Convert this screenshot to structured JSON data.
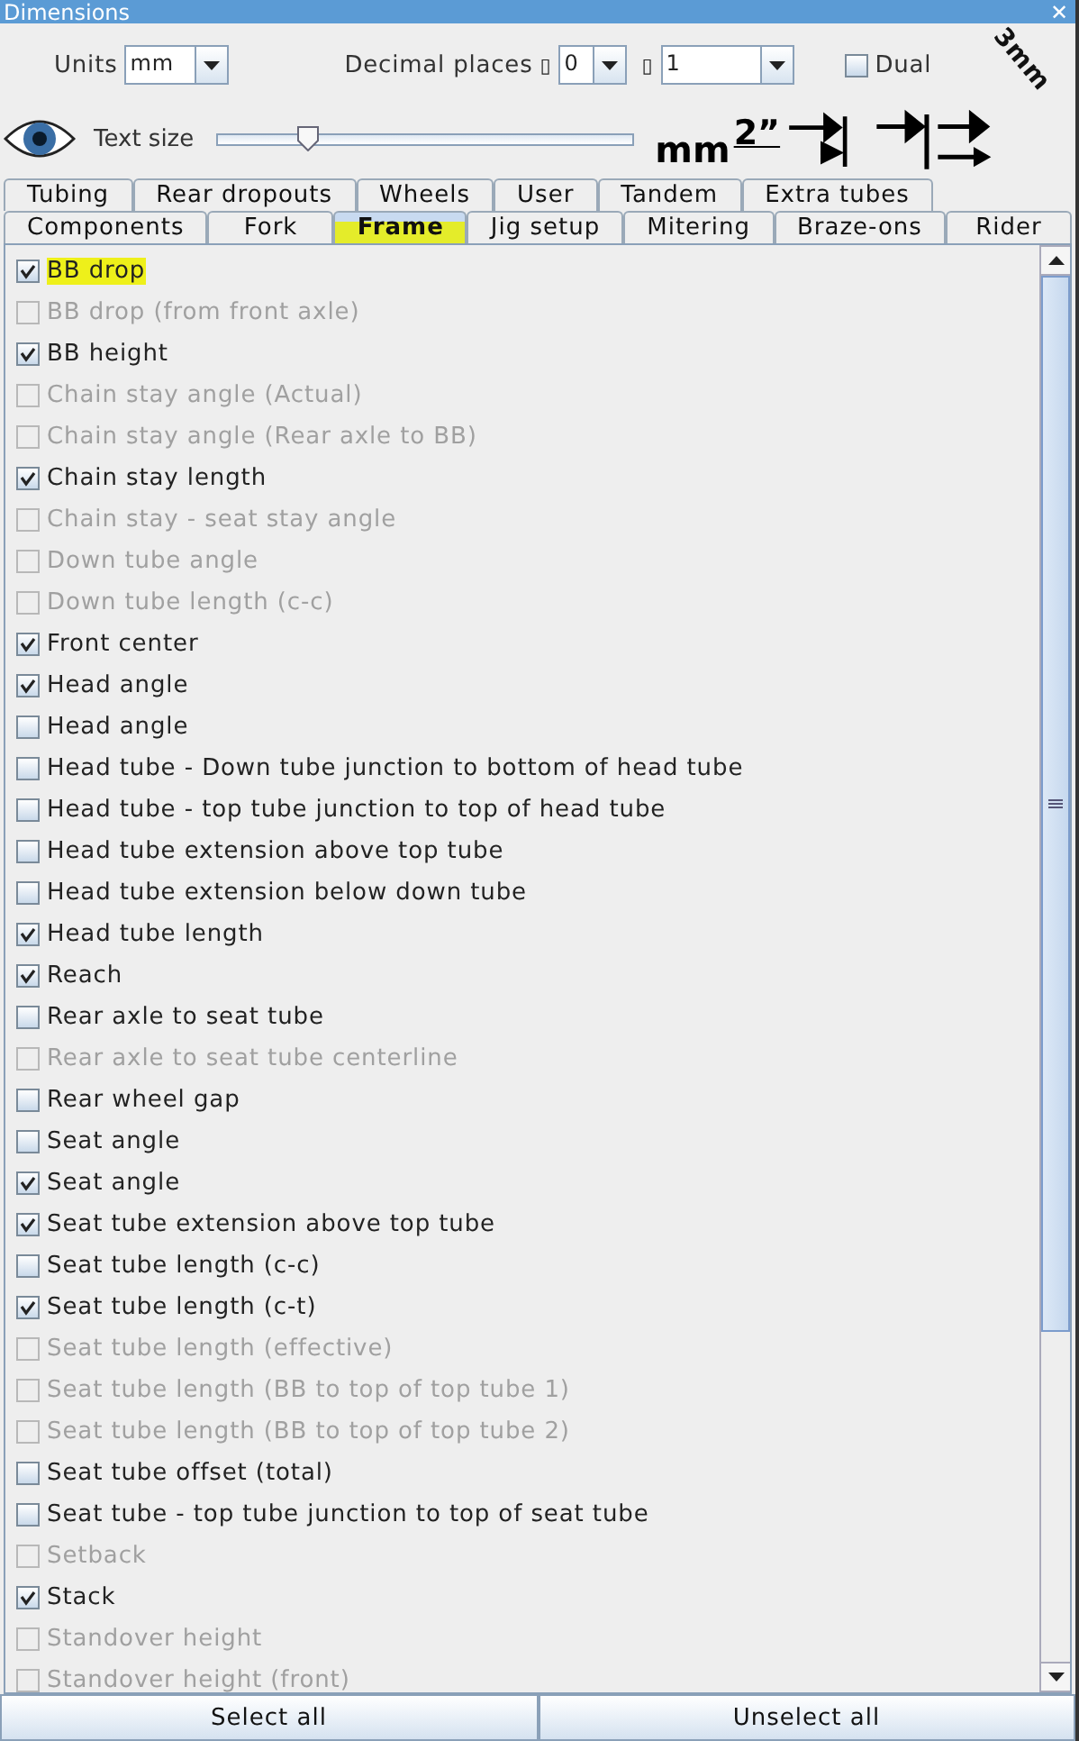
{
  "window": {
    "title": "Dimensions",
    "close": "✕"
  },
  "units": {
    "label": "Units",
    "value": "mm"
  },
  "decimal_places": {
    "label": "Decimal places",
    "glyph_1": "▯",
    "value_1": "0",
    "glyph_2": "▯",
    "value_2": "1"
  },
  "dual": {
    "label": "Dual",
    "checked": false
  },
  "corner_label": "3mm",
  "text_size": {
    "label": "Text size",
    "level": 0.22
  },
  "unit_buttons": [
    {
      "kind": "text",
      "label": "mm"
    },
    {
      "kind": "inch",
      "label": "2”"
    },
    {
      "kind": "arrow_bar"
    },
    {
      "kind": "arrow_bar_short"
    },
    {
      "kind": "double_arrow"
    }
  ],
  "tab_rows": [
    [
      {
        "label": "Tubing",
        "selected": false,
        "highlighted": false
      },
      {
        "label": "Rear dropouts",
        "selected": false,
        "highlighted": false
      },
      {
        "label": "Wheels",
        "selected": false,
        "highlighted": false
      },
      {
        "label": "User",
        "selected": false,
        "highlighted": false
      },
      {
        "label": "Tandem",
        "selected": false,
        "highlighted": false
      },
      {
        "label": "Extra tubes",
        "selected": false,
        "highlighted": false
      }
    ],
    [
      {
        "label": "Components",
        "selected": false,
        "highlighted": false
      },
      {
        "label": "Fork",
        "selected": false,
        "highlighted": false
      },
      {
        "label": "Frame",
        "selected": true,
        "highlighted": true
      },
      {
        "label": "Jig setup",
        "selected": false,
        "highlighted": false
      },
      {
        "label": "Mitering",
        "selected": false,
        "highlighted": false
      },
      {
        "label": "Braze-ons",
        "selected": false,
        "highlighted": false
      },
      {
        "label": "Rider",
        "selected": false,
        "highlighted": false
      }
    ]
  ],
  "items": [
    {
      "label": "BB drop",
      "checked": true,
      "disabled": false,
      "highlighted": true
    },
    {
      "label": "BB drop (from front axle)",
      "checked": false,
      "disabled": true,
      "highlighted": false
    },
    {
      "label": "BB height",
      "checked": true,
      "disabled": false,
      "highlighted": false
    },
    {
      "label": "Chain stay angle (Actual)",
      "checked": false,
      "disabled": true,
      "highlighted": false
    },
    {
      "label": "Chain stay angle (Rear axle to BB)",
      "checked": false,
      "disabled": true,
      "highlighted": false
    },
    {
      "label": "Chain stay length",
      "checked": true,
      "disabled": false,
      "highlighted": false
    },
    {
      "label": "Chain stay - seat stay angle",
      "checked": false,
      "disabled": true,
      "highlighted": false
    },
    {
      "label": "Down tube angle",
      "checked": false,
      "disabled": true,
      "highlighted": false
    },
    {
      "label": "Down tube length (c-c)",
      "checked": false,
      "disabled": true,
      "highlighted": false
    },
    {
      "label": "Front center",
      "checked": true,
      "disabled": false,
      "highlighted": false
    },
    {
      "label": "Head angle",
      "checked": true,
      "disabled": false,
      "highlighted": false
    },
    {
      "label": "Head angle",
      "checked": false,
      "disabled": false,
      "highlighted": false
    },
    {
      "label": "Head tube - Down tube junction to bottom of head tube",
      "checked": false,
      "disabled": false,
      "highlighted": false
    },
    {
      "label": "Head tube - top tube junction to top of head tube",
      "checked": false,
      "disabled": false,
      "highlighted": false
    },
    {
      "label": "Head tube extension above top tube",
      "checked": false,
      "disabled": false,
      "highlighted": false
    },
    {
      "label": "Head tube extension below down tube",
      "checked": false,
      "disabled": false,
      "highlighted": false
    },
    {
      "label": "Head tube length",
      "checked": true,
      "disabled": false,
      "highlighted": false
    },
    {
      "label": "Reach",
      "checked": true,
      "disabled": false,
      "highlighted": false
    },
    {
      "label": "Rear axle to seat tube",
      "checked": false,
      "disabled": false,
      "highlighted": false
    },
    {
      "label": "Rear axle to seat tube centerline",
      "checked": false,
      "disabled": true,
      "highlighted": false
    },
    {
      "label": "Rear wheel gap",
      "checked": false,
      "disabled": false,
      "highlighted": false
    },
    {
      "label": "Seat angle",
      "checked": false,
      "disabled": false,
      "highlighted": false
    },
    {
      "label": "Seat angle",
      "checked": true,
      "disabled": false,
      "highlighted": false
    },
    {
      "label": "Seat tube extension above top tube",
      "checked": true,
      "disabled": false,
      "highlighted": false
    },
    {
      "label": "Seat tube length (c-c)",
      "checked": false,
      "disabled": false,
      "highlighted": false
    },
    {
      "label": "Seat tube length (c-t)",
      "checked": true,
      "disabled": false,
      "highlighted": false
    },
    {
      "label": "Seat tube length (effective)",
      "checked": false,
      "disabled": true,
      "highlighted": false
    },
    {
      "label": "Seat tube length (BB to top of top tube 1)",
      "checked": false,
      "disabled": true,
      "highlighted": false
    },
    {
      "label": "Seat tube length (BB to top of top tube 2)",
      "checked": false,
      "disabled": true,
      "highlighted": false
    },
    {
      "label": "Seat tube offset (total)",
      "checked": false,
      "disabled": false,
      "highlighted": false
    },
    {
      "label": "Seat tube - top tube junction to top of seat tube",
      "checked": false,
      "disabled": false,
      "highlighted": false
    },
    {
      "label": "Setback",
      "checked": false,
      "disabled": true,
      "highlighted": false
    },
    {
      "label": "Stack",
      "checked": true,
      "disabled": false,
      "highlighted": false
    },
    {
      "label": "Standover height",
      "checked": false,
      "disabled": true,
      "highlighted": false
    },
    {
      "label": "Standover height (front)",
      "checked": false,
      "disabled": true,
      "highlighted": false
    }
  ],
  "buttons": [
    "Select all",
    "Unselect all"
  ]
}
